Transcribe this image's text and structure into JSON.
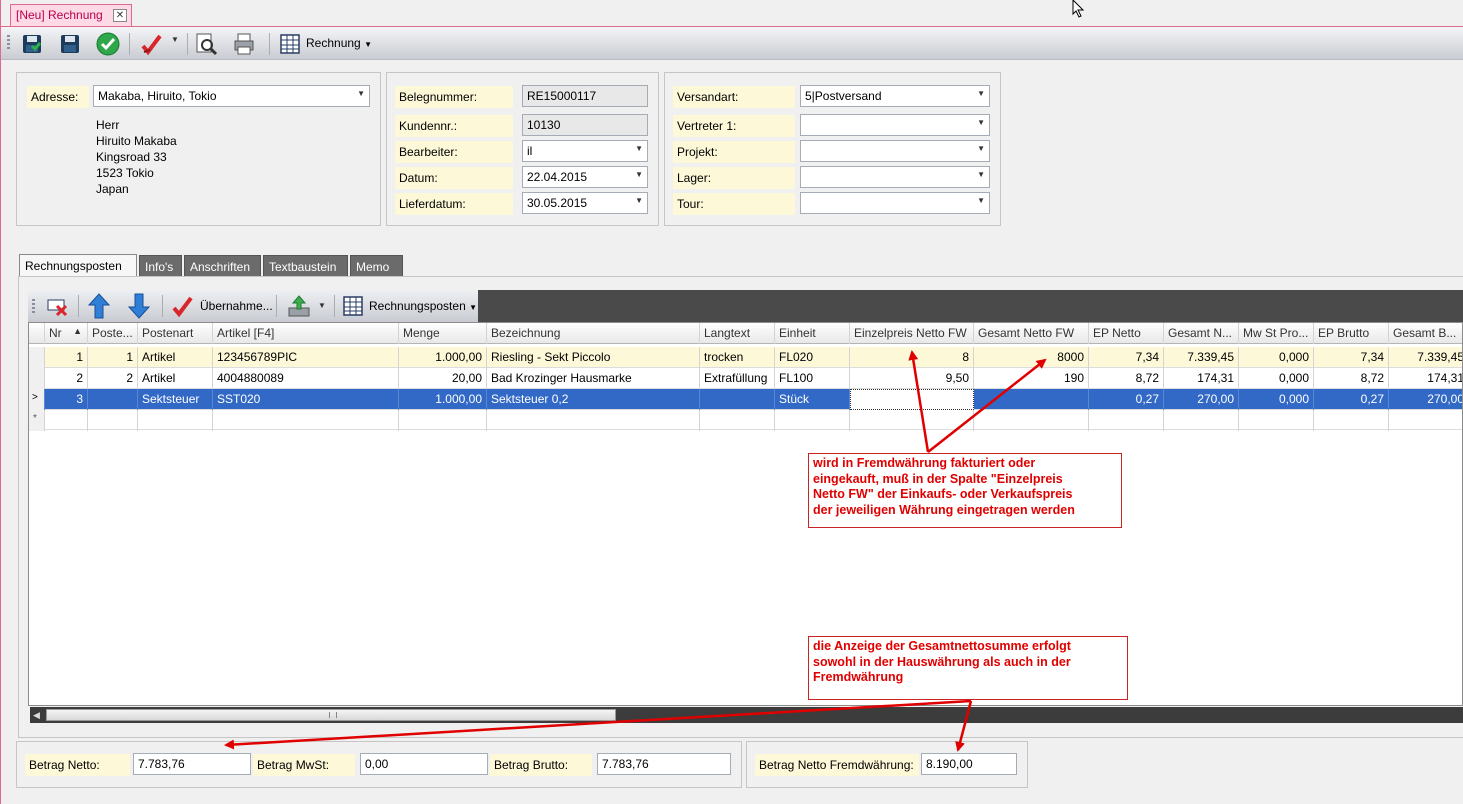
{
  "window": {
    "tab_title": "[Neu] Rechnung",
    "close_glyph": "✕"
  },
  "toolbar": {
    "report_label": "Rechnung"
  },
  "address": {
    "label": "Adresse:",
    "value": "Makaba, Hiruito, Tokio",
    "lines": [
      "Herr",
      "Hiruito Makaba",
      "Kingsroad  33",
      "1523 Tokio",
      "Japan"
    ]
  },
  "docinfo": {
    "belegnummer_label": "Belegnummer:",
    "belegnummer": "RE15000117",
    "kundennr_label": "Kundennr.:",
    "kundennr": "10130",
    "bearbeiter_label": "Bearbeiter:",
    "bearbeiter": "il",
    "datum_label": "Datum:",
    "datum": "22.04.2015",
    "lieferdatum_label": "Lieferdatum:",
    "lieferdatum": "30.05.2015"
  },
  "shipping": {
    "versandart_label": "Versandart:",
    "versandart": "5|Postversand",
    "vertreter_label": "Vertreter 1:",
    "vertreter": "",
    "projekt_label": "Projekt:",
    "projekt": "",
    "lager_label": "Lager:",
    "lager": "",
    "tour_label": "Tour:",
    "tour": ""
  },
  "tabs": [
    {
      "label": "Rechnungsposten"
    },
    {
      "label": "Info's"
    },
    {
      "label": "Anschriften"
    },
    {
      "label": "Textbaustein"
    },
    {
      "label": "Memo"
    }
  ],
  "grid_toolbar": {
    "uebernahme_label": "Übernahme...",
    "posten_label": "Rechnungsposten"
  },
  "grid": {
    "headers": [
      "Nr",
      "Poste...",
      "Postenart",
      "Artikel [F4]",
      "Menge",
      "Bezeichnung",
      "Langtext",
      "Einheit",
      "Einzelpreis Netto FW",
      "Gesamt Netto FW",
      "EP Netto",
      "Gesamt N...",
      "Mw St Pro...",
      "EP Brutto",
      "Gesamt B..."
    ],
    "sort_glyph": "▲",
    "rows": [
      [
        "1",
        "1",
        "Artikel",
        "123456789PIC",
        "1.000,00",
        "Riesling - Sekt Piccolo",
        "trocken",
        "FL020",
        "8",
        "8000",
        "7,34",
        "7.339,45",
        "0,000",
        "7,34",
        "7.339,45"
      ],
      [
        "2",
        "2",
        "Artikel",
        "4004880089",
        "20,00",
        "Bad Krozinger Hausmarke",
        "Extrafüllung",
        "FL100",
        "9,50",
        "190",
        "8,72",
        "174,31",
        "0,000",
        "8,72",
        "174,31"
      ],
      [
        "3",
        "",
        "Sektsteuer",
        "SST020",
        "1.000,00",
        "Sektsteuer 0,2",
        "",
        "Stück",
        "",
        "",
        "0,27",
        "270,00",
        "0,000",
        "0,27",
        "270,00"
      ]
    ],
    "new_row_marker": "*"
  },
  "annotations": {
    "note1": [
      "wird in Fremdwährung fakturiert oder",
      "eingekauft, muß in der Spalte \"Einzelpreis",
      "Netto FW\" der Einkaufs- oder Verkaufspreis",
      "der jeweiligen Währung eingetragen werden"
    ],
    "note2": [
      "die Anzeige der Gesamtnettosumme erfolgt",
      "sowohl in der Hauswährung als auch in der",
      "Fremdwährung"
    ]
  },
  "totals": {
    "netto_label": "Betrag Netto:",
    "netto": "7.783,76",
    "mwst_label": "Betrag MwSt:",
    "mwst": "0,00",
    "brutto_label": "Betrag Brutto:",
    "brutto": "7.783,76",
    "fw_label": "Betrag Netto Fremdwährung:",
    "fw": "8.190,00"
  },
  "colors": {
    "accent_tab": "#e06a8c",
    "field_label_bg": "#fdf8d8",
    "selection": "#3269c6",
    "annotation": "#e00000"
  }
}
